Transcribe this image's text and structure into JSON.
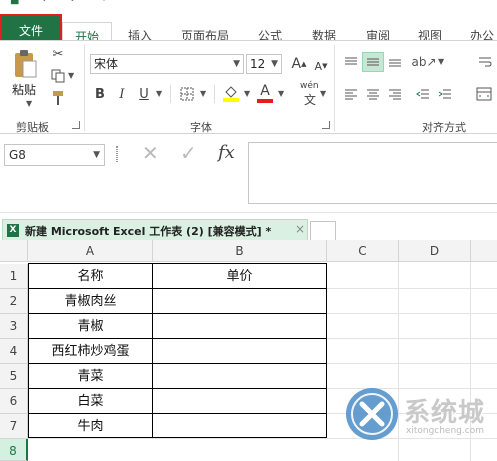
{
  "ribbon_tabs": {
    "file": "文件",
    "home": "开始",
    "insert": "插入",
    "page_layout": "页面布局",
    "formulas": "公式",
    "data": "数据",
    "review": "审阅",
    "view": "视图",
    "office": "办公"
  },
  "clipboard": {
    "paste_label": "粘贴",
    "group_label": "剪贴板"
  },
  "font": {
    "name": "宋体",
    "size": "12",
    "bold": "B",
    "italic": "I",
    "underline": "U",
    "grow": "A",
    "shrink": "A",
    "color_letter": "A",
    "phonetic": "wén",
    "group_label": "字体"
  },
  "alignment": {
    "group_label": "对齐方式"
  },
  "formula_bar": {
    "name_box": "G8",
    "fx": "fx",
    "formula_value": ""
  },
  "workbook": {
    "title": "新建 Microsoft Excel 工作表 (2)  [兼容模式] *",
    "icon_letter": "X",
    "close": "×"
  },
  "sheet": {
    "columns": [
      "A",
      "B",
      "C",
      "D"
    ],
    "rows": [
      "1",
      "2",
      "3",
      "4",
      "5",
      "6",
      "7",
      "8"
    ],
    "cells": [
      [
        "名称",
        "单价"
      ],
      [
        "青椒肉丝",
        ""
      ],
      [
        "青椒",
        ""
      ],
      [
        "西红柿炒鸡蛋",
        ""
      ],
      [
        "青菜",
        ""
      ],
      [
        "白菜",
        ""
      ],
      [
        "牛肉",
        ""
      ],
      [
        "",
        ""
      ]
    ]
  },
  "colors": {
    "excel_green": "#217346",
    "file_tab_highlight": "#e02020",
    "font_color": "#e02020",
    "highlight_color": "#ffff00"
  },
  "watermark": {
    "text": "系统城",
    "sub": "xitongcheng.com"
  }
}
